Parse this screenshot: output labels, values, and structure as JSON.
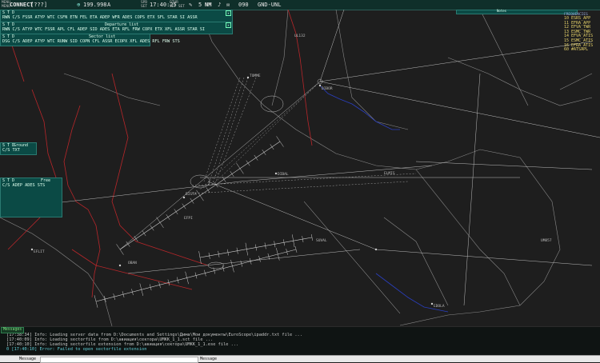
{
  "topbar": {
    "connect_label": "CONNECT",
    "connect_status": "[???]",
    "frequency": "199.998",
    "atis_letter": "A",
    "speed_small_1": "SPD",
    "speed_small_2": "SET",
    "time": "17:40:25",
    "other_small_1": "OTHR",
    "other_small_2": "SET SET",
    "range_val": "5",
    "range_unit": "NM",
    "alt_val": "090",
    "alt_range": "GND-UNL"
  },
  "panels": {
    "arrivals": {
      "columns": "RWN C/S  FSSR ATYP WTC CSFN  ETN  FEL  ETA  ADEP WFR ADES COPS  ETX  SFL  STAR  SI  ASSR"
    },
    "departures": {
      "columns": "RWN C/S  ATYP WTC FSSR  APL  CFL ADEP SID     ADES  ETA  RFL FRW COPX  ETX  XFL  ASSR STAR  SI",
      "title": "Departure list"
    },
    "sector_list": {
      "title": "Sector list",
      "columns": "DSG C/S   ADEP ATYP WTC RUNW SID    COPN  CFL  ASSR ECOPX  XFL ADES RFL FRW STS"
    },
    "ground": {
      "title": "Ground",
      "columns": "C/S    TXT"
    },
    "free": {
      "title": "Free",
      "columns": "C/S     ADEP  ADES   STS"
    }
  },
  "legend": {
    "title": "Notes",
    "header": "FREQUENCIES",
    "lines": [
      "10 ESRS_APP",
      "11 EFRA_APP",
      "12 EFVA_TWR",
      "13 ESMC_TWR",
      "14 EFVA_ATIS",
      "15 ESMC_ATIS",
      "16 EFRA_ATIS",
      "60 #ATSAPL"
    ]
  },
  "map_labels": [
    {
      "text": "TOMME",
      "color": "#bbbbbb"
    },
    {
      "text": "DIBOR",
      "color": "#bbbbbb"
    },
    {
      "text": "UL132",
      "color": "#bbbbbb"
    },
    {
      "text": "DIBAL",
      "color": "#bbbbbb"
    },
    {
      "text": "BISTA",
      "color": "#bbbbbb"
    },
    {
      "text": "EFPI",
      "color": "#bbbbbb"
    },
    {
      "text": "ELMIS",
      "color": "#bbbbbb"
    },
    {
      "text": "UM857",
      "color": "#bbbbbb"
    },
    {
      "text": "SUVAL",
      "color": "#bbbbbb"
    },
    {
      "text": "EDOLA",
      "color": "#bbbbbb"
    },
    {
      "text": "EFLIT",
      "color": "#bbbbbb"
    },
    {
      "text": "OBAN",
      "color": "#bbbbbb"
    }
  ],
  "log": {
    "tab_label": "Messages",
    "lines": [
      "[17:38:34] Info: Loading server data from D:\\Documents and Settings\\Дима\\Мои документы\\EuroScope\\ipaddr.txt file ...",
      "[17:40:09] Info: Loading sectorfile from D:\\авиация\\сектора\\UMKK_1_1.sct file ...",
      "[17:40:10] Info: Loading sectorfile extension from D:\\авиация\\сектора\\UMKK_1_1.ese file ...",
      "0 [17:40:10] Error: Failed to open sectorfile extension"
    ]
  },
  "command_line": {
    "label_left": "Message",
    "label_right": "Message",
    "value": ""
  },
  "colors": {
    "panel_bg": "#0b4a45",
    "background": "#1e1e1e",
    "airway": "#bcbcbc",
    "border_red": "#b8262a",
    "coast_blue": "#2a3fc0"
  }
}
